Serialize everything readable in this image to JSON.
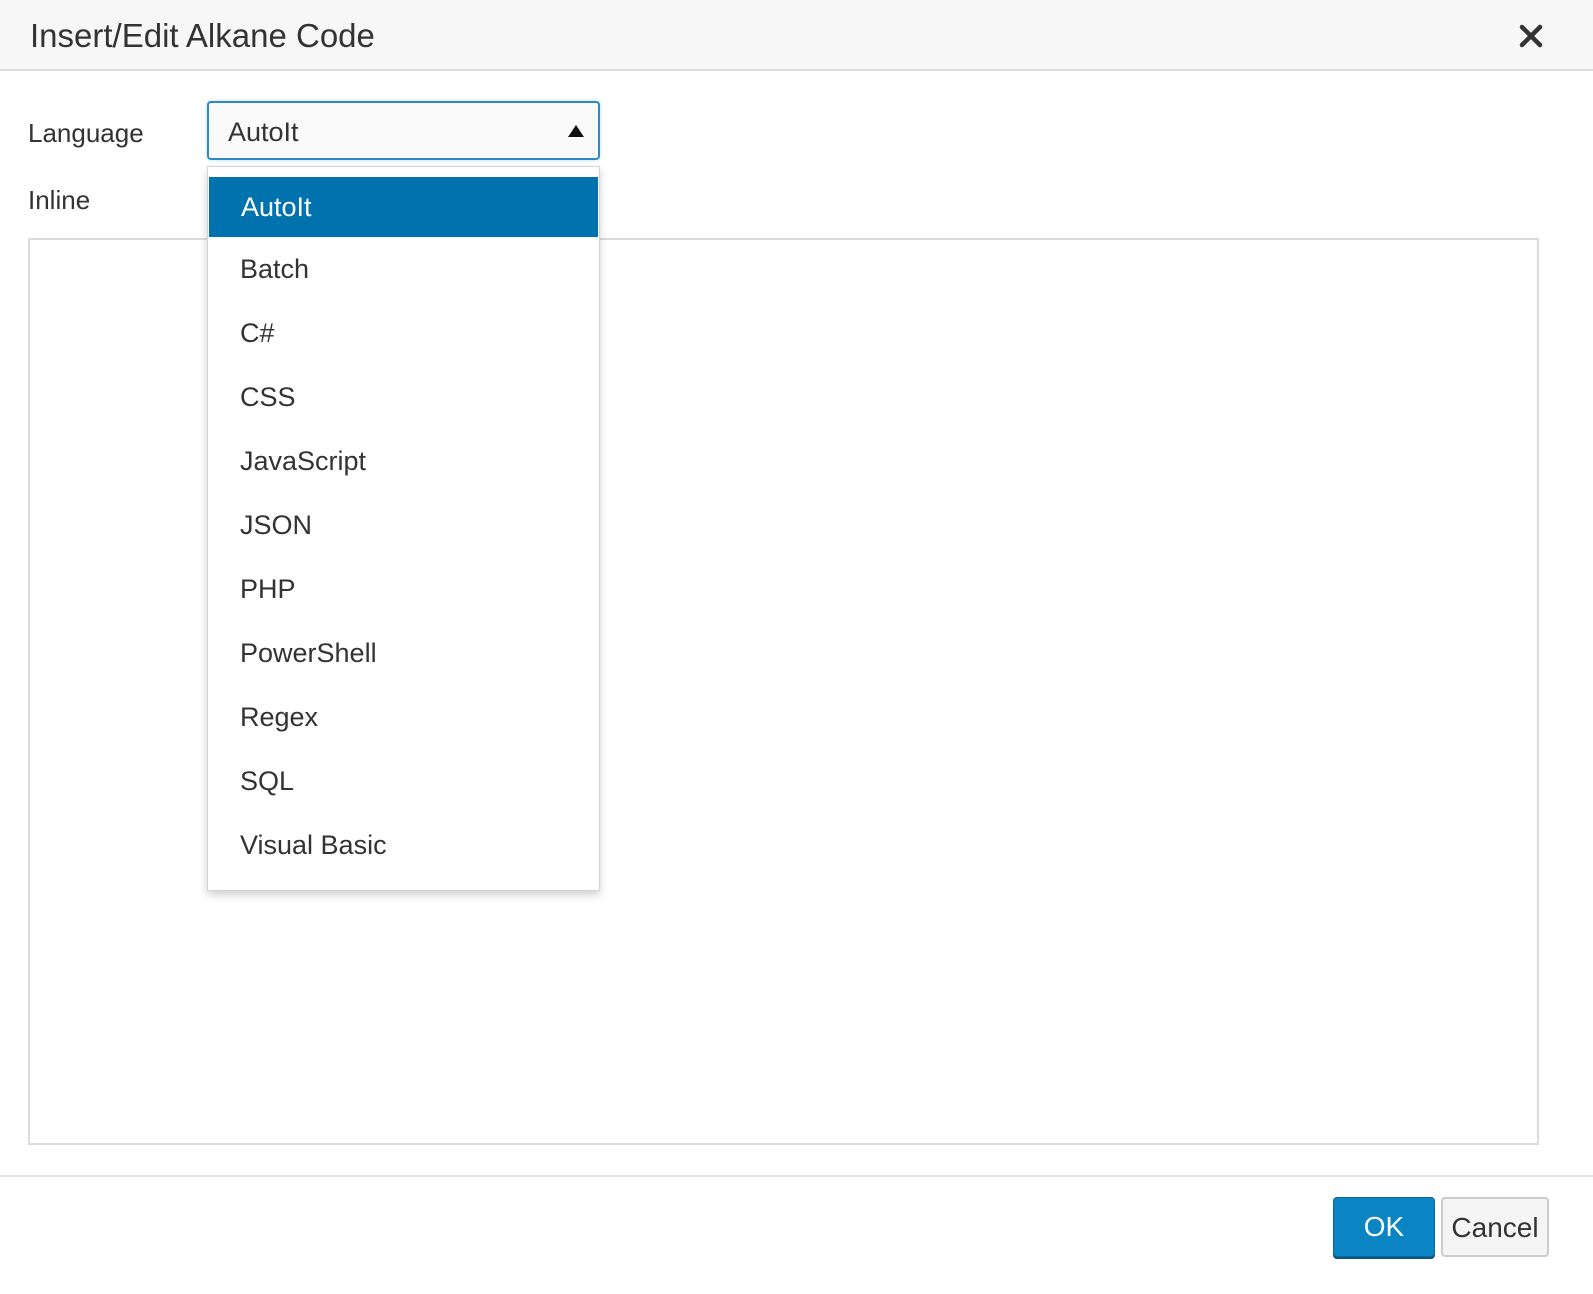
{
  "dialog": {
    "title": "Insert/Edit Alkane Code",
    "close_icon": "close-icon"
  },
  "form": {
    "language_label": "Language",
    "inline_label": "Inline",
    "language_value": "AutoIt",
    "editor_value": ""
  },
  "dropdown": {
    "selected": "AutoIt",
    "options": [
      "AutoIt",
      "Batch",
      "C#",
      "CSS",
      "JavaScript",
      "JSON",
      "PHP",
      "PowerShell",
      "Regex",
      "SQL",
      "Visual Basic"
    ]
  },
  "buttons": {
    "ok": "OK",
    "cancel": "Cancel"
  },
  "colors": {
    "accent": "#0073ae",
    "ok_button": "#0a84c2",
    "focus_border": "#2d8ac7"
  }
}
